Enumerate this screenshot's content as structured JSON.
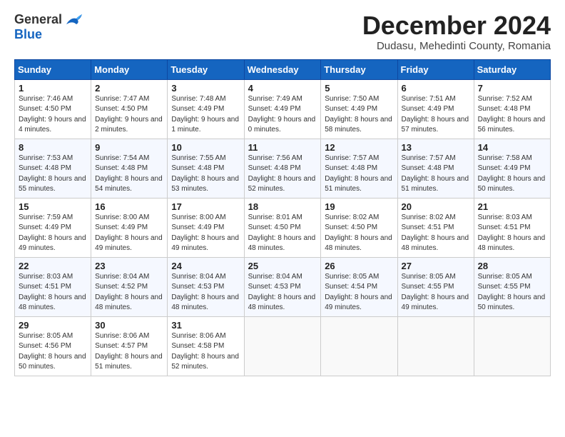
{
  "logo": {
    "general": "General",
    "blue": "Blue"
  },
  "title": "December 2024",
  "location": "Dudasu, Mehedinti County, Romania",
  "headers": [
    "Sunday",
    "Monday",
    "Tuesday",
    "Wednesday",
    "Thursday",
    "Friday",
    "Saturday"
  ],
  "weeks": [
    [
      {
        "day": "1",
        "rise": "7:46 AM",
        "set": "4:50 PM",
        "daylight": "9 hours and 4 minutes."
      },
      {
        "day": "2",
        "rise": "7:47 AM",
        "set": "4:50 PM",
        "daylight": "9 hours and 2 minutes."
      },
      {
        "day": "3",
        "rise": "7:48 AM",
        "set": "4:49 PM",
        "daylight": "9 hours and 1 minute."
      },
      {
        "day": "4",
        "rise": "7:49 AM",
        "set": "4:49 PM",
        "daylight": "9 hours and 0 minutes."
      },
      {
        "day": "5",
        "rise": "7:50 AM",
        "set": "4:49 PM",
        "daylight": "8 hours and 58 minutes."
      },
      {
        "day": "6",
        "rise": "7:51 AM",
        "set": "4:49 PM",
        "daylight": "8 hours and 57 minutes."
      },
      {
        "day": "7",
        "rise": "7:52 AM",
        "set": "4:48 PM",
        "daylight": "8 hours and 56 minutes."
      }
    ],
    [
      {
        "day": "8",
        "rise": "7:53 AM",
        "set": "4:48 PM",
        "daylight": "8 hours and 55 minutes."
      },
      {
        "day": "9",
        "rise": "7:54 AM",
        "set": "4:48 PM",
        "daylight": "8 hours and 54 minutes."
      },
      {
        "day": "10",
        "rise": "7:55 AM",
        "set": "4:48 PM",
        "daylight": "8 hours and 53 minutes."
      },
      {
        "day": "11",
        "rise": "7:56 AM",
        "set": "4:48 PM",
        "daylight": "8 hours and 52 minutes."
      },
      {
        "day": "12",
        "rise": "7:57 AM",
        "set": "4:48 PM",
        "daylight": "8 hours and 51 minutes."
      },
      {
        "day": "13",
        "rise": "7:57 AM",
        "set": "4:48 PM",
        "daylight": "8 hours and 51 minutes."
      },
      {
        "day": "14",
        "rise": "7:58 AM",
        "set": "4:49 PM",
        "daylight": "8 hours and 50 minutes."
      }
    ],
    [
      {
        "day": "15",
        "rise": "7:59 AM",
        "set": "4:49 PM",
        "daylight": "8 hours and 49 minutes."
      },
      {
        "day": "16",
        "rise": "8:00 AM",
        "set": "4:49 PM",
        "daylight": "8 hours and 49 minutes."
      },
      {
        "day": "17",
        "rise": "8:00 AM",
        "set": "4:49 PM",
        "daylight": "8 hours and 49 minutes."
      },
      {
        "day": "18",
        "rise": "8:01 AM",
        "set": "4:50 PM",
        "daylight": "8 hours and 48 minutes."
      },
      {
        "day": "19",
        "rise": "8:02 AM",
        "set": "4:50 PM",
        "daylight": "8 hours and 48 minutes."
      },
      {
        "day": "20",
        "rise": "8:02 AM",
        "set": "4:51 PM",
        "daylight": "8 hours and 48 minutes."
      },
      {
        "day": "21",
        "rise": "8:03 AM",
        "set": "4:51 PM",
        "daylight": "8 hours and 48 minutes."
      }
    ],
    [
      {
        "day": "22",
        "rise": "8:03 AM",
        "set": "4:51 PM",
        "daylight": "8 hours and 48 minutes."
      },
      {
        "day": "23",
        "rise": "8:04 AM",
        "set": "4:52 PM",
        "daylight": "8 hours and 48 minutes."
      },
      {
        "day": "24",
        "rise": "8:04 AM",
        "set": "4:53 PM",
        "daylight": "8 hours and 48 minutes."
      },
      {
        "day": "25",
        "rise": "8:04 AM",
        "set": "4:53 PM",
        "daylight": "8 hours and 48 minutes."
      },
      {
        "day": "26",
        "rise": "8:05 AM",
        "set": "4:54 PM",
        "daylight": "8 hours and 49 minutes."
      },
      {
        "day": "27",
        "rise": "8:05 AM",
        "set": "4:55 PM",
        "daylight": "8 hours and 49 minutes."
      },
      {
        "day": "28",
        "rise": "8:05 AM",
        "set": "4:55 PM",
        "daylight": "8 hours and 50 minutes."
      }
    ],
    [
      {
        "day": "29",
        "rise": "8:05 AM",
        "set": "4:56 PM",
        "daylight": "8 hours and 50 minutes."
      },
      {
        "day": "30",
        "rise": "8:06 AM",
        "set": "4:57 PM",
        "daylight": "8 hours and 51 minutes."
      },
      {
        "day": "31",
        "rise": "8:06 AM",
        "set": "4:58 PM",
        "daylight": "8 hours and 52 minutes."
      },
      null,
      null,
      null,
      null
    ]
  ],
  "labels": {
    "sunrise": "Sunrise:",
    "sunset": "Sunset:",
    "daylight": "Daylight:"
  }
}
